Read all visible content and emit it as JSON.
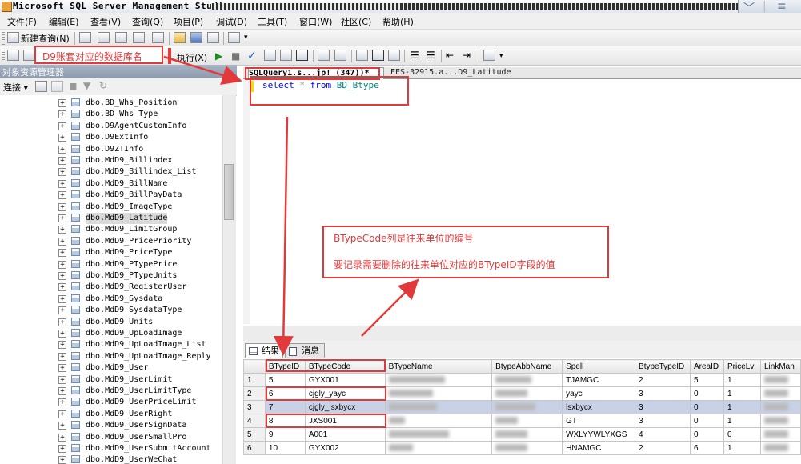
{
  "window": {
    "title": "Microsoft SQL Server Management Studio"
  },
  "menu": [
    "文件(F)",
    "编辑(E)",
    "查看(V)",
    "查询(Q)",
    "项目(P)",
    "调试(D)",
    "工具(T)",
    "窗口(W)",
    "社区(C)",
    "帮助(H)"
  ],
  "toolbar": {
    "new_query": "新建查询(N)",
    "execute": "执行(X)"
  },
  "object_explorer": {
    "title": "对象资源管理器",
    "connect": "连接",
    "items": [
      "dbo.BD_Whs_Position",
      "dbo.BD_Whs_Type",
      "dbo.D9AgentCustomInfo",
      "dbo.D9ExtInfo",
      "dbo.D9ZTInfo",
      "dbo.MdD9_Billindex",
      "dbo.MdD9_Billindex_List",
      "dbo.MdD9_BillName",
      "dbo.MdD9_BillPayData",
      "dbo.MdD9_ImageType",
      "dbo.MdD9_Latitude",
      "dbo.MdD9_LimitGroup",
      "dbo.MdD9_PricePriority",
      "dbo.MdD9_PriceType",
      "dbo.MdD9_PTypePrice",
      "dbo.MdD9_PTypeUnits",
      "dbo.MdD9_RegisterUser",
      "dbo.MdD9_Sysdata",
      "dbo.MdD9_SysdataType",
      "dbo.MdD9_Units",
      "dbo.MdD9_UpLoadImage",
      "dbo.MdD9_UpLoadImage_List",
      "dbo.MdD9_UpLoadImage_Reply",
      "dbo.MdD9_User",
      "dbo.MdD9_UserLimit",
      "dbo.MdD9_UserLimitType",
      "dbo.MdD9_UserPriceLimit",
      "dbo.MdD9_UserRight",
      "dbo.MdD9_UserSignData",
      "dbo.MdD9_UserSmallPro",
      "dbo.MdD9_UserSubmitAccount",
      "dbo.MdD9_UserWeChat"
    ],
    "selected_item": "dbo.MdD9_Latitude"
  },
  "editor": {
    "tabs": [
      "SQLQuery1.s...jp! (347))*",
      "EES-32915.a...D9_Latitude"
    ],
    "code": {
      "kw1": "select",
      "star": "*",
      "kw2": "from",
      "table": "BD_Btype"
    }
  },
  "results": {
    "tabs": [
      "结果",
      "消息"
    ],
    "columns": [
      "BTypeID",
      "BTypeCode",
      "BTypeName",
      "BtypeAbbName",
      "Spell",
      "BtypeTypeID",
      "AreaID",
      "PriceLvl",
      "LinkMan"
    ],
    "rows": [
      {
        "n": "1",
        "id": "5",
        "code": "GYX001",
        "spell": "TJAMGC",
        "type": "2",
        "area": "5",
        "price": "1"
      },
      {
        "n": "2",
        "id": "6",
        "code": "cjgly_yayc",
        "spell": "yayc",
        "type": "3",
        "area": "0",
        "price": "1"
      },
      {
        "n": "3",
        "id": "7",
        "code": "cjgly_lsxbycx",
        "spell": "lsxbycx",
        "type": "3",
        "area": "0",
        "price": "1"
      },
      {
        "n": "4",
        "id": "8",
        "code": "JXS001",
        "spell": "GT",
        "type": "3",
        "area": "0",
        "price": "1"
      },
      {
        "n": "5",
        "id": "9",
        "code": "A001",
        "spell": "WXLYYWLYXGS",
        "type": "4",
        "area": "0",
        "price": "0"
      },
      {
        "n": "6",
        "id": "10",
        "code": "GYX002",
        "spell": "HNAMGC",
        "type": "2",
        "area": "6",
        "price": "1"
      }
    ],
    "highlighted_row": "3"
  },
  "annotations": {
    "db_note": "D9账套对应的数据库名",
    "code_note": "BTypeCode列是往来单位的编号",
    "id_note": "要记录需要删除的往来单位对应的BTypeID字段的值",
    "color": "#e23a3a"
  }
}
